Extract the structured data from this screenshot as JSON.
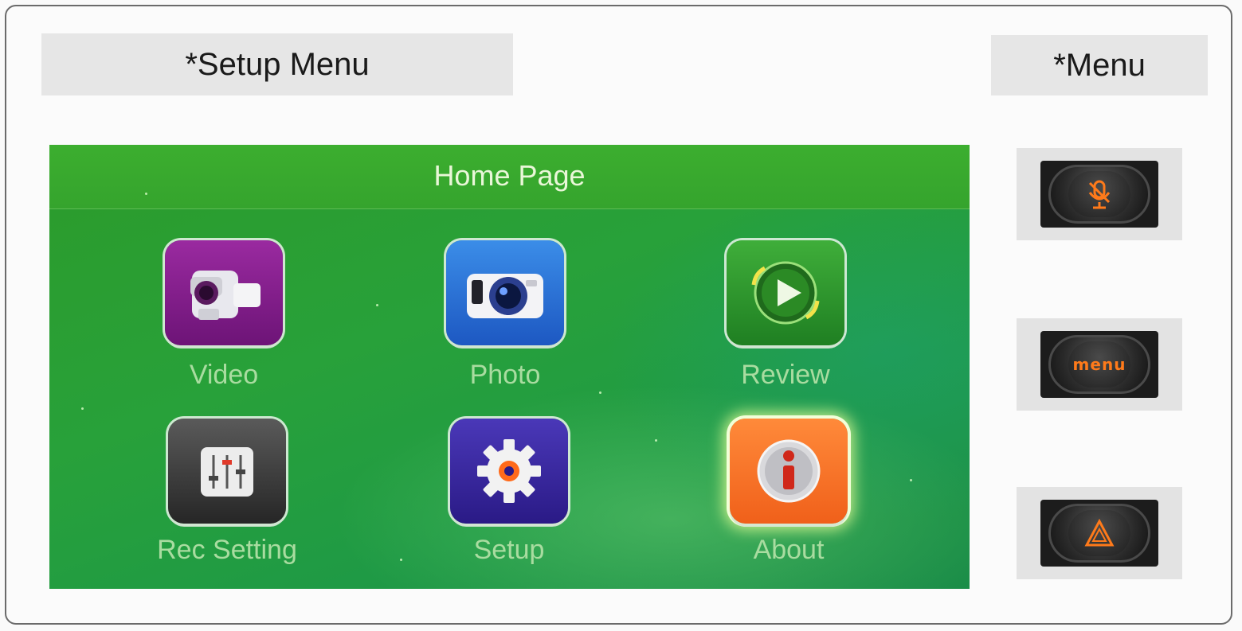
{
  "labels": {
    "setup_menu": "*Setup Menu",
    "menu": "*Menu"
  },
  "screen": {
    "title": "Home Page",
    "tiles": [
      {
        "label": "Video",
        "icon": "video-camera-icon",
        "color": "#8a1f92"
      },
      {
        "label": "Photo",
        "icon": "photo-camera-icon",
        "color": "#2a70d8"
      },
      {
        "label": "Review",
        "icon": "play-review-icon",
        "color": "#2f9a2c"
      },
      {
        "label": "Rec Setting",
        "icon": "sliders-icon",
        "color": "#3a3a3a"
      },
      {
        "label": "Setup",
        "icon": "gear-icon",
        "color": "#3a28a0"
      },
      {
        "label": "About",
        "icon": "info-icon",
        "color": "#f57a2a",
        "selected": true
      }
    ]
  },
  "hardware_buttons": [
    {
      "icon": "mic-mute-icon"
    },
    {
      "icon": "menu-icon",
      "text": "menu"
    },
    {
      "icon": "warning-triangle-icon"
    }
  ],
  "colors": {
    "screen_green": "#2a9e35",
    "button_accent": "#ff7a1a",
    "tile_label": "#a9dca0"
  }
}
